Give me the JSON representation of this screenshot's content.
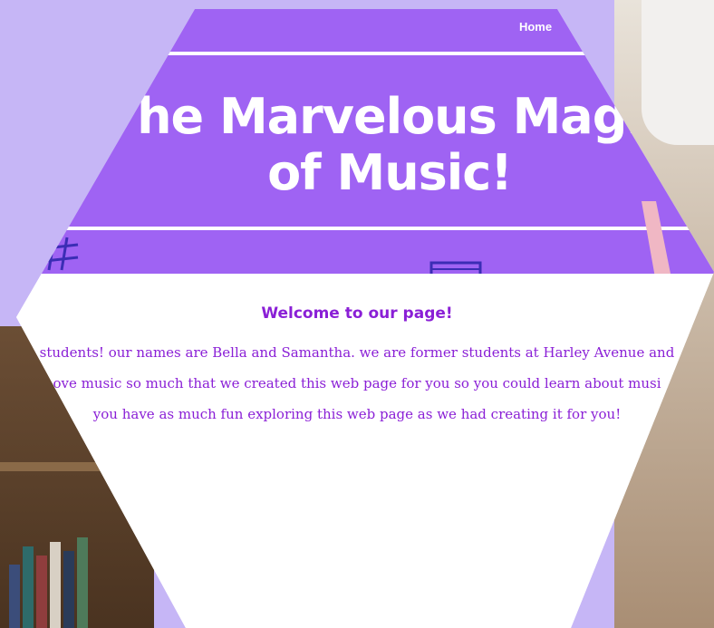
{
  "nav": {
    "home_label": "Home"
  },
  "hero": {
    "title_line1": "he Marvelous Magi",
    "title_line2": "of Music!"
  },
  "content": {
    "heading": "Welcome to our page!",
    "lines": [
      "students! our names are Bella and Samantha. we are former students at Harley Avenue and",
      "ove music so much that we created this web page for you so you could learn about musi",
      "you have as much fun exploring this web page as we had creating it for you!"
    ]
  },
  "colors": {
    "banner": "#9f63f3",
    "frame": "#c6b6f6",
    "text_accent": "#8a1fd6"
  }
}
